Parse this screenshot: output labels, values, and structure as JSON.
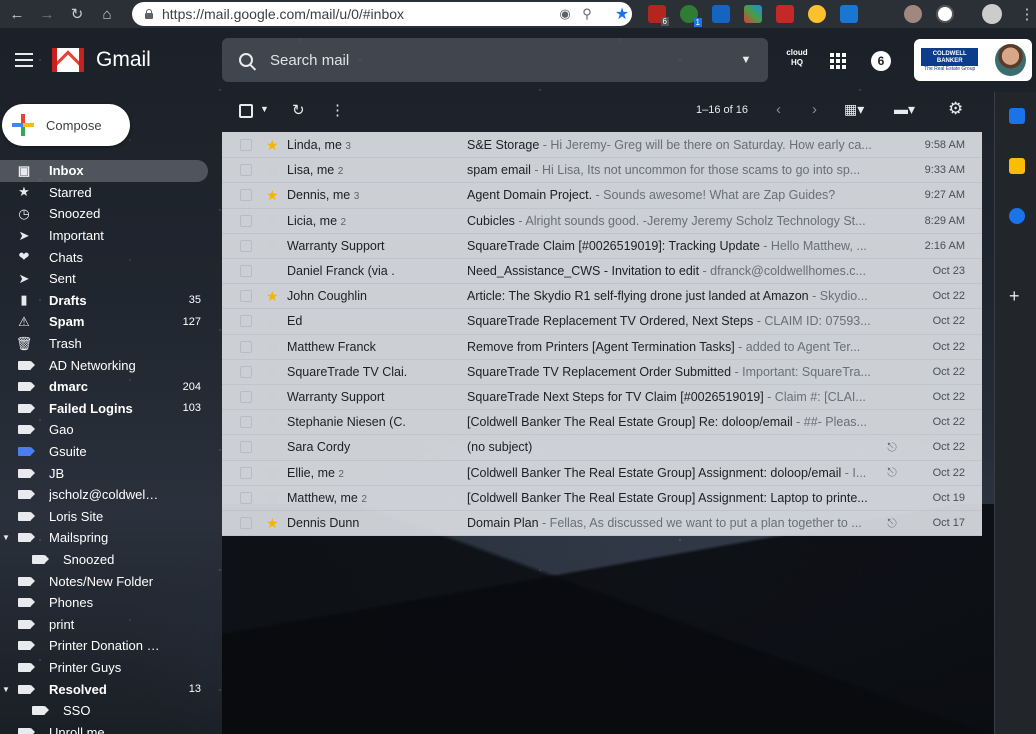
{
  "browser": {
    "url": "https://mail.google.com/mail/u/0/#inbox",
    "extension_badges": [
      "6",
      "1"
    ]
  },
  "header": {
    "logo_text": "Gmail",
    "search_placeholder": "Search mail",
    "hq_label": "cloud HQ",
    "notification_count": "6",
    "account_logo_text": "COLDWELL BANKER",
    "account_logo_sub": "The Real Estate Group"
  },
  "compose_label": "Compose",
  "sidebar": {
    "items": [
      {
        "label": "Inbox",
        "count": "",
        "icon": "inbox-icon",
        "active": true
      },
      {
        "label": "Starred",
        "count": "",
        "icon": "star-icon"
      },
      {
        "label": "Snoozed",
        "count": "",
        "icon": "clock-icon"
      },
      {
        "label": "Important",
        "count": "",
        "icon": "important-icon"
      },
      {
        "label": "Chats",
        "count": "",
        "icon": "chat-icon"
      },
      {
        "label": "Sent",
        "count": "",
        "icon": "send-icon"
      },
      {
        "label": "Drafts",
        "count": "35",
        "icon": "draft-icon",
        "bold": true
      },
      {
        "label": "Spam",
        "count": "127",
        "icon": "spam-icon",
        "bold": true
      },
      {
        "label": "Trash",
        "count": "",
        "icon": "trash-icon"
      },
      {
        "label": "AD Networking",
        "count": "",
        "icon": "label-icon"
      },
      {
        "label": "dmarc",
        "count": "204",
        "icon": "label-icon",
        "bold": true
      },
      {
        "label": "Failed Logins",
        "count": "103",
        "icon": "label-icon",
        "bold": true
      },
      {
        "label": "Gao",
        "count": "",
        "icon": "label-icon"
      },
      {
        "label": "Gsuite",
        "count": "",
        "icon": "label-icon",
        "color": "#4a7df0"
      },
      {
        "label": "JB",
        "count": "",
        "icon": "label-icon"
      },
      {
        "label": "jscholz@coldwellhomes....",
        "count": "",
        "icon": "label-icon"
      },
      {
        "label": "Loris Site",
        "count": "",
        "icon": "label-icon"
      },
      {
        "label": "Mailspring",
        "count": "",
        "icon": "label-icon",
        "expander": true
      },
      {
        "label": "Snoozed",
        "count": "",
        "icon": "label-icon",
        "sub": true
      },
      {
        "label": "Notes/New Folder",
        "count": "",
        "icon": "label-icon"
      },
      {
        "label": "Phones",
        "count": "",
        "icon": "label-icon"
      },
      {
        "label": "print",
        "count": "",
        "icon": "label-icon"
      },
      {
        "label": "Printer Donation Receipts",
        "count": "",
        "icon": "label-icon"
      },
      {
        "label": "Printer Guys",
        "count": "",
        "icon": "label-icon"
      },
      {
        "label": "Resolved",
        "count": "13",
        "icon": "label-icon",
        "bold": true,
        "expander": true
      },
      {
        "label": "SSO",
        "count": "",
        "icon": "label-icon",
        "sub": true
      },
      {
        "label": "Unroll.me",
        "count": "",
        "icon": "label-icon"
      }
    ]
  },
  "toolbar": {
    "pagination": "1–16 of 16"
  },
  "emails": [
    {
      "sender": "Linda, me",
      "count": "3",
      "starred": true,
      "subject": "S&E Storage",
      "snippet": " - Hi Jeremy- Greg will be there on Saturday. How early ca...",
      "date": "9:58 AM",
      "attachment": false
    },
    {
      "sender": "Lisa, me",
      "count": "2",
      "starred": false,
      "subject": "spam email",
      "snippet": " - Hi Lisa, Its not uncommon for those scams to go into sp...",
      "date": "9:33 AM",
      "attachment": false
    },
    {
      "sender": "Dennis, me",
      "count": "3",
      "starred": true,
      "subject": "Agent Domain Project.",
      "snippet": " - Sounds awesome! What are Zap Guides?",
      "date": "9:27 AM",
      "attachment": false
    },
    {
      "sender": "Licia, me",
      "count": "2",
      "starred": false,
      "subject": "Cubicles",
      "snippet": " - Alright sounds good. -Jeremy Jeremy Scholz Technology St...",
      "date": "8:29 AM",
      "attachment": false
    },
    {
      "sender": "Warranty Support",
      "count": "",
      "starred": false,
      "subject": "SquareTrade Claim [#0026519019]: Tracking Update",
      "snippet": " - Hello Matthew, ...",
      "date": "2:16 AM",
      "attachment": false
    },
    {
      "sender": "Daniel Franck (via .",
      "count": "",
      "starred": false,
      "subject": "Need_Assistance_CWS - Invitation to edit",
      "snippet": " - dfranck@coldwellhomes.c...",
      "date": "Oct 23",
      "attachment": false
    },
    {
      "sender": "John Coughlin",
      "count": "",
      "starred": true,
      "subject": "Article: The Skydio R1 self-flying drone just landed at Amazon",
      "snippet": " - Skydio...",
      "date": "Oct 22",
      "attachment": false
    },
    {
      "sender": "Ed",
      "count": "",
      "starred": false,
      "subject": "SquareTrade Replacement TV Ordered, Next Steps",
      "snippet": " - CLAIM ID: 07593...",
      "date": "Oct 22",
      "attachment": false
    },
    {
      "sender": "Matthew Franck",
      "count": "",
      "starred": false,
      "subject": "Remove from Printers [Agent Termination Tasks]",
      "snippet": " - added to Agent Ter...",
      "date": "Oct 22",
      "attachment": false
    },
    {
      "sender": "SquareTrade TV Clai.",
      "count": "",
      "starred": false,
      "subject": "SquareTrade TV Replacement Order Submitted",
      "snippet": " - Important: SquareTra...",
      "date": "Oct 22",
      "attachment": false
    },
    {
      "sender": "Warranty Support",
      "count": "",
      "starred": false,
      "subject": "SquareTrade Next Steps for TV Claim [#0026519019]",
      "snippet": " - Claim #: [CLAI...",
      "date": "Oct 22",
      "attachment": false
    },
    {
      "sender": "Stephanie Niesen (C.",
      "count": "",
      "starred": false,
      "subject": "[Coldwell Banker The Real Estate Group] Re: doloop/email",
      "snippet": " - ##- Pleas...",
      "date": "Oct 22",
      "attachment": false
    },
    {
      "sender": "Sara Cordy",
      "count": "",
      "starred": false,
      "subject": "(no subject)",
      "snippet": "",
      "date": "Oct 22",
      "attachment": true
    },
    {
      "sender": "Ellie, me",
      "count": "2",
      "starred": false,
      "subject": "[Coldwell Banker The Real Estate Group] Assignment: doloop/email",
      "snippet": " - I...",
      "date": "Oct 22",
      "attachment": true
    },
    {
      "sender": "Matthew, me",
      "count": "2",
      "starred": false,
      "subject": "[Coldwell Banker The Real Estate Group] Assignment: Laptop to printe...",
      "snippet": "",
      "date": "Oct 19",
      "attachment": false
    },
    {
      "sender": "Dennis Dunn",
      "count": "",
      "starred": true,
      "subject": "Domain Plan",
      "snippet": " - Fellas, As discussed we want to put a plan together to ...",
      "date": "Oct 17",
      "attachment": true
    }
  ],
  "colors": {
    "accent_blue": "#1a73e8",
    "star_yellow": "#f4b400",
    "gmail_red": "#ea4335"
  }
}
